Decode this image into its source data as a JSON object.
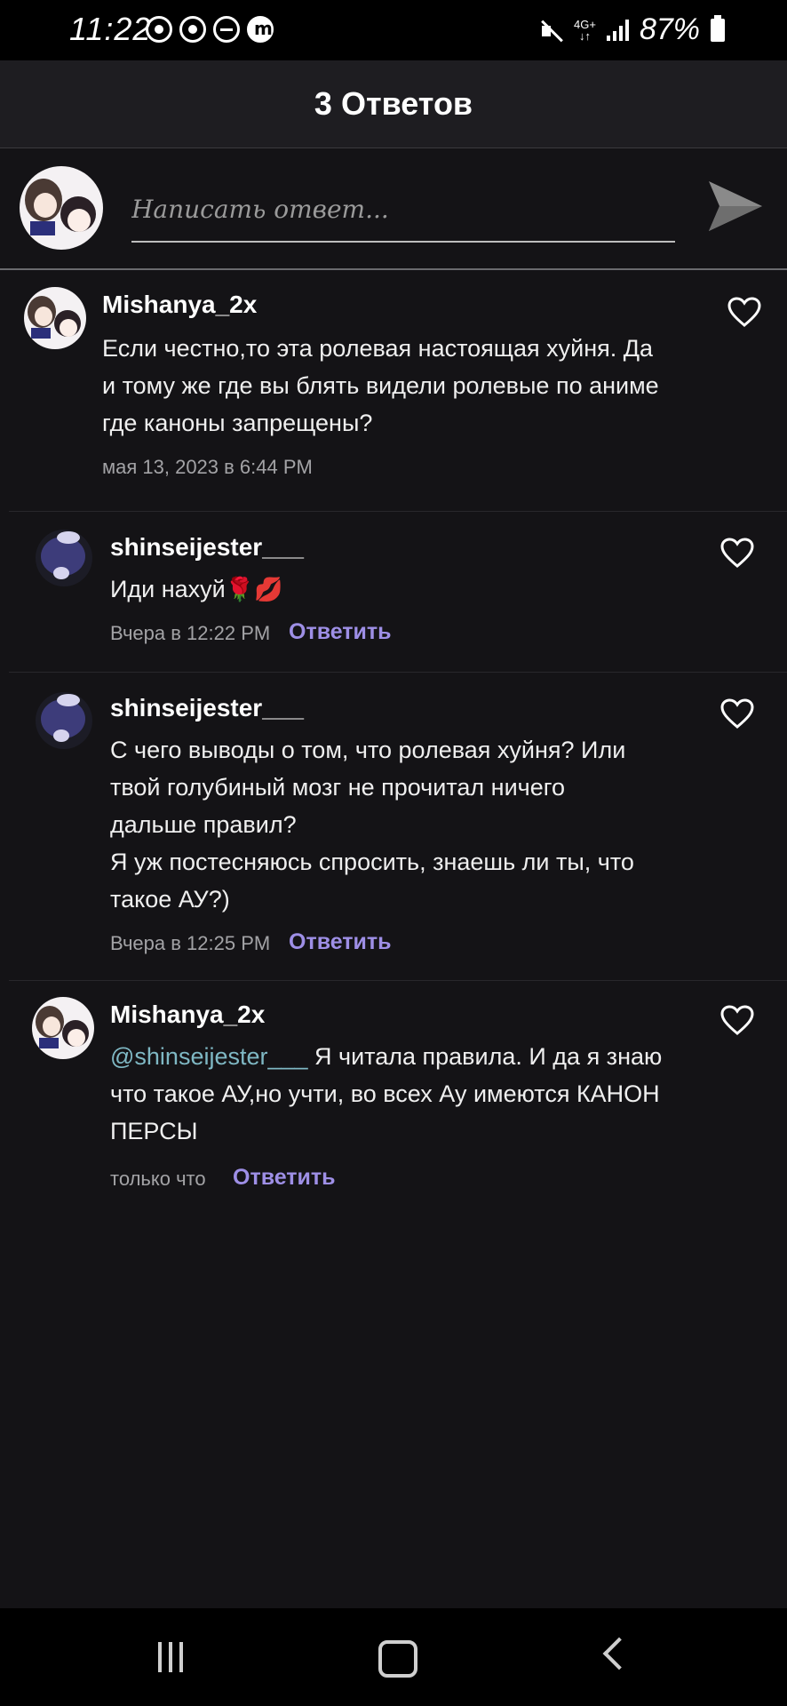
{
  "status_bar": {
    "time": "11:22",
    "network": "4G+",
    "battery": "87%"
  },
  "header": {
    "title": "3 Ответов"
  },
  "composer": {
    "placeholder": "Написать ответ..."
  },
  "comments": [
    {
      "username": "Mishanya_2x",
      "text": "Если честно,то эта ролевая настоящая хуйня. Да\nи тому же где вы блять видели ролевые  по аниме\nгде каноны запрещены?",
      "timestamp": "мая 13, 2023 в 6:44 PM",
      "reply_label": ""
    },
    {
      "username": "shinseijester___",
      "text": "Иди нахуй",
      "emoji": "🌹💋",
      "timestamp": "Вчера в 12:22 PM",
      "reply_label": "Ответить"
    },
    {
      "username": "shinseijester___",
      "text": "С чего выводы о том, что ролевая хуйня? Или\nтвой голубиный мозг не прочитал ничего\nдальше правил?\nЯ уж постесняюсь спросить, знаешь ли ты, что\nтакое АУ?)",
      "timestamp": "Вчера в 12:25 PM",
      "reply_label": "Ответить"
    },
    {
      "username": "Mishanya_2x",
      "mention": "@shinseijester___",
      "text": " Я читала правила. И да я знаю\nчто такое АУ,но учти, во всех Ау имеются КАНОН\nПЕРСЫ",
      "timestamp": "только что",
      "reply_label": "Ответить"
    }
  ],
  "colors": {
    "background": "#141316",
    "header": "#1e1d21",
    "accent_reply": "#9e8fe6",
    "mention": "#7fb8c4",
    "meta": "#a3a3a6"
  },
  "icons": [
    "send-icon",
    "heart-icon",
    "recents-icon",
    "home-icon",
    "back-icon"
  ]
}
